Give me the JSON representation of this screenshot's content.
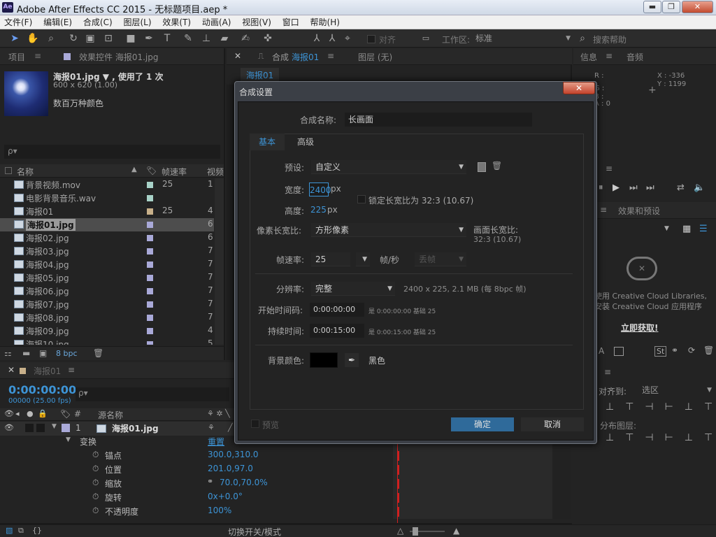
{
  "window": {
    "title": "Adobe After Effects CC 2015 - 无标题项目.aep *",
    "logo": "Ae",
    "minimize": "▬",
    "maximize": "❐",
    "close": "✕"
  },
  "menu": [
    "文件(F)",
    "编辑(E)",
    "合成(C)",
    "图层(L)",
    "效果(T)",
    "动画(A)",
    "视图(V)",
    "窗口",
    "帮助(H)"
  ],
  "toolbar": {
    "snap_label": "对齐",
    "workspace_label": "工作区:",
    "workspace_value": "标准",
    "search_placeholder": "搜索帮助"
  },
  "project_panel": {
    "tab_project": "项目",
    "tab_effects": "效果控件 海报01.jpg",
    "preview_name": "海报01.jpg ▼ , 使用了 1 次",
    "preview_dims": "600 x 620 (1.00)",
    "preview_colors": "数百万种颜色",
    "search_placeholder": "ρ▾",
    "col_name": "名称",
    "col_fps": "帧速率",
    "col_size": "视频",
    "bpc": "8 bpc",
    "items": [
      {
        "name": "背景视频.mov",
        "fps": "25",
        "size": "1",
        "color": "#a8d2c8"
      },
      {
        "name": "电影背景音乐.wav",
        "fps": "",
        "size": "",
        "color": "#a8d2c8"
      },
      {
        "name": "海报01",
        "fps": "25",
        "size": "4",
        "color": "#c8b08a"
      },
      {
        "name": "海报01.jpg",
        "fps": "",
        "size": "6",
        "color": "#a9a9d8"
      },
      {
        "name": "海报02.jpg",
        "fps": "",
        "size": "6",
        "color": "#a9a9d8"
      },
      {
        "name": "海报03.jpg",
        "fps": "",
        "size": "7",
        "color": "#a9a9d8"
      },
      {
        "name": "海报04.jpg",
        "fps": "",
        "size": "7",
        "color": "#a9a9d8"
      },
      {
        "name": "海报05.jpg",
        "fps": "",
        "size": "7",
        "color": "#a9a9d8"
      },
      {
        "name": "海报06.jpg",
        "fps": "",
        "size": "7",
        "color": "#a9a9d8"
      },
      {
        "name": "海报07.jpg",
        "fps": "",
        "size": "7",
        "color": "#a9a9d8"
      },
      {
        "name": "海报08.jpg",
        "fps": "",
        "size": "7",
        "color": "#a9a9d8"
      },
      {
        "name": "海报09.jpg",
        "fps": "",
        "size": "4",
        "color": "#a9a9d8"
      },
      {
        "name": "海报10.jpg",
        "fps": "",
        "size": "5",
        "color": "#a9a9d8"
      }
    ]
  },
  "comp_panel": {
    "tab_comp_prefix": "合成",
    "tab_comp_name": "海报01",
    "tab_layer": "图层 (无)",
    "breadcrumb": "海报01"
  },
  "info_panel": {
    "tab_info": "信息",
    "tab_audio": "音频",
    "r": "R :",
    "g": "G :",
    "b": "B :",
    "a": "A : 0",
    "x": "X : -336",
    "y": "Y : 1199"
  },
  "effects_panel": {
    "tab_effects": "效果和预设",
    "cc_line1": "使用 Creative Cloud Libraries,",
    "cc_line2": "安装 Creative Cloud 应用程序",
    "cc_link": "立即获取!",
    "align_label": "对齐到:",
    "align_value": "选区",
    "distribute_label": "分布图层:"
  },
  "timeline": {
    "tab_name": "海报01",
    "timecode": "0:00:00:00",
    "frames": "00000 (25.00 fps)",
    "col_num": "#",
    "col_source": "源名称",
    "layer_num": "1",
    "layer_name": "海报01.jpg",
    "transform": "变换",
    "reset": "重置",
    "props": [
      {
        "name": "锚点",
        "value": "300.0,310.0"
      },
      {
        "name": "位置",
        "value": "201.0,97.0"
      },
      {
        "name": "缩放",
        "value": "70.0,70.0%"
      },
      {
        "name": "旋转",
        "value": "0x+0.0°"
      },
      {
        "name": "不透明度",
        "value": "100%"
      }
    ],
    "toggle_label": "切换开关/模式"
  },
  "dialog": {
    "title": "合成设置",
    "close": "✕",
    "name_label": "合成名称:",
    "name_value": "长画面",
    "tab_basic": "基本",
    "tab_advanced": "高级",
    "preset_label": "预设:",
    "preset_value": "自定义",
    "width_label": "宽度:",
    "width_value": "2400",
    "width_unit": "px",
    "height_label": "高度:",
    "height_value": "225",
    "height_unit": "px",
    "lock_label": "锁定长宽比为 32:3 (10.67)",
    "par_label": "像素长宽比:",
    "par_value": "方形像素",
    "frame_aspect_label": "画面长宽比:",
    "frame_aspect_value": "32:3 (10.67)",
    "fps_label": "帧速率:",
    "fps_value": "25",
    "fps_unit": "帧/秒",
    "dropframe": "丢帧",
    "res_label": "分辨率:",
    "res_value": "完整",
    "res_info": "2400 x 225, 2.1 MB (每 8bpc 帧)",
    "start_label": "开始时间码:",
    "start_value": "0:00:00:00",
    "start_info": "是 0:00:00:00  基础 25",
    "dur_label": "持续时间:",
    "dur_value": "0:00:15:00",
    "dur_info": "是 0:00:15:00  基础 25",
    "bg_label": "背景颜色:",
    "bg_name": "黑色",
    "bg_color": "#000000",
    "preview_label": "预览",
    "ok": "确定",
    "cancel": "取消"
  },
  "colors": {
    "accent": "#3d94d6",
    "ok_button": "#2f6a9a",
    "timeline_marker": "#d02020"
  }
}
